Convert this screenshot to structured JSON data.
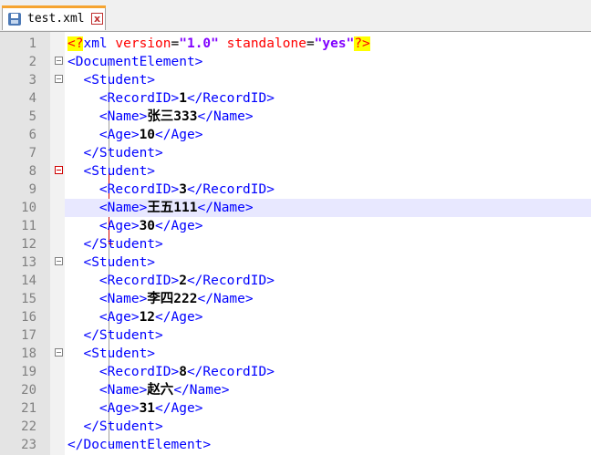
{
  "tab": {
    "filename": "test.xml",
    "icon": "save-icon",
    "close_icon": "close-icon",
    "close_glyph": "x"
  },
  "lines": [
    {
      "n": "1",
      "tokens": [
        [
          "pi",
          "<?"
        ],
        [
          "tag",
          "xml "
        ],
        [
          "attr",
          "version"
        ],
        [
          "eq",
          "="
        ],
        [
          "str",
          "\"1.0\""
        ],
        [
          "tag",
          " "
        ],
        [
          "attr",
          "standalone"
        ],
        [
          "eq",
          "="
        ],
        [
          "str",
          "\"yes\""
        ],
        [
          "pi",
          "?>"
        ]
      ]
    },
    {
      "n": "2",
      "tokens": [
        [
          "tag",
          "<DocumentElement>"
        ]
      ]
    },
    {
      "n": "3",
      "tokens": [
        [
          "tag",
          "  <Student>"
        ]
      ]
    },
    {
      "n": "4",
      "tokens": [
        [
          "tag",
          "    <RecordID>"
        ],
        [
          "txt",
          "1"
        ],
        [
          "tag",
          "</RecordID>"
        ]
      ]
    },
    {
      "n": "5",
      "tokens": [
        [
          "tag",
          "    <Name>"
        ],
        [
          "txt",
          "张三333"
        ],
        [
          "tag",
          "</Name>"
        ]
      ]
    },
    {
      "n": "6",
      "tokens": [
        [
          "tag",
          "    <Age>"
        ],
        [
          "txt",
          "10"
        ],
        [
          "tag",
          "</Age>"
        ]
      ]
    },
    {
      "n": "7",
      "tokens": [
        [
          "tag",
          "  </Student>"
        ]
      ]
    },
    {
      "n": "8",
      "tokens": [
        [
          "tag",
          "  <Student>"
        ]
      ]
    },
    {
      "n": "9",
      "tokens": [
        [
          "tag",
          "    <RecordID>"
        ],
        [
          "txt",
          "3"
        ],
        [
          "tag",
          "</RecordID>"
        ]
      ]
    },
    {
      "n": "10",
      "tokens": [
        [
          "tag",
          "    <Name>"
        ],
        [
          "txt",
          "王五111"
        ],
        [
          "tag",
          "</Name>"
        ]
      ]
    },
    {
      "n": "11",
      "tokens": [
        [
          "tag",
          "    <Age>"
        ],
        [
          "txt",
          "30"
        ],
        [
          "tag",
          "</Age>"
        ]
      ]
    },
    {
      "n": "12",
      "tokens": [
        [
          "tag",
          "  </Student>"
        ]
      ]
    },
    {
      "n": "13",
      "tokens": [
        [
          "tag",
          "  <Student>"
        ]
      ]
    },
    {
      "n": "14",
      "tokens": [
        [
          "tag",
          "    <RecordID>"
        ],
        [
          "txt",
          "2"
        ],
        [
          "tag",
          "</RecordID>"
        ]
      ]
    },
    {
      "n": "15",
      "tokens": [
        [
          "tag",
          "    <Name>"
        ],
        [
          "txt",
          "李四222"
        ],
        [
          "tag",
          "</Name>"
        ]
      ]
    },
    {
      "n": "16",
      "tokens": [
        [
          "tag",
          "    <Age>"
        ],
        [
          "txt",
          "12"
        ],
        [
          "tag",
          "</Age>"
        ]
      ]
    },
    {
      "n": "17",
      "tokens": [
        [
          "tag",
          "  </Student>"
        ]
      ]
    },
    {
      "n": "18",
      "tokens": [
        [
          "tag",
          "  <Student>"
        ]
      ]
    },
    {
      "n": "19",
      "tokens": [
        [
          "tag",
          "    <RecordID>"
        ],
        [
          "txt",
          "8"
        ],
        [
          "tag",
          "</RecordID>"
        ]
      ]
    },
    {
      "n": "20",
      "tokens": [
        [
          "tag",
          "    <Name>"
        ],
        [
          "txt",
          "赵六"
        ],
        [
          "tag",
          "</Name>"
        ]
      ]
    },
    {
      "n": "21",
      "tokens": [
        [
          "tag",
          "    <Age>"
        ],
        [
          "txt",
          "31"
        ],
        [
          "tag",
          "</Age>"
        ]
      ]
    },
    {
      "n": "22",
      "tokens": [
        [
          "tag",
          "  </Student>"
        ]
      ]
    },
    {
      "n": "23",
      "tokens": [
        [
          "tag",
          "</DocumentElement>"
        ]
      ]
    }
  ],
  "current_line": "10",
  "colors": {
    "tag": "#0000ff",
    "attribute": "#ff0000",
    "string": "#8000ff",
    "current_line_bg": "#e8e8ff",
    "tab_accent": "#f6a431"
  }
}
